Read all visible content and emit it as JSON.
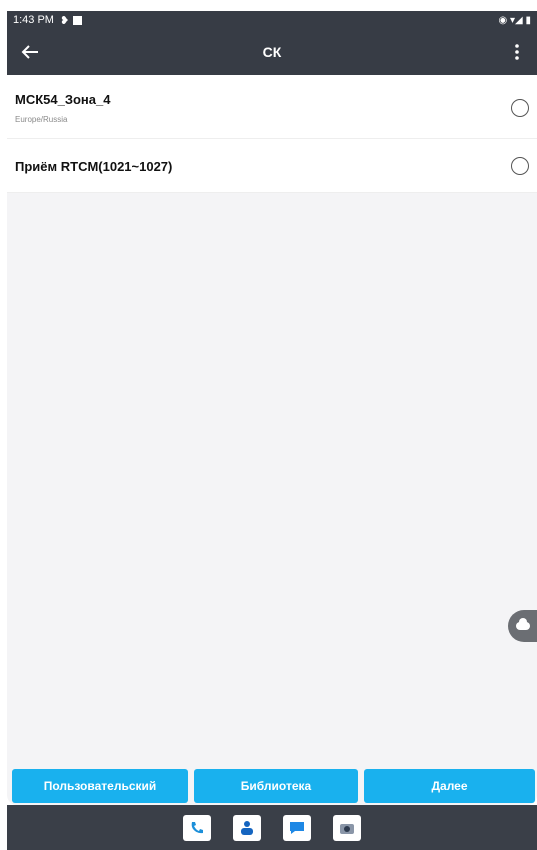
{
  "status_bar": {
    "time": "1:43 PM",
    "right_text": "◉ ▾◢ ▮"
  },
  "app_bar": {
    "title": "СК",
    "back_icon": "arrow-back-icon",
    "menu_icon": "more-vert-icon"
  },
  "list": {
    "items": [
      {
        "label": "МСК54_Зона_4",
        "sublabel": "Europe/Russia",
        "selected": false
      },
      {
        "label": "Приём RTCM(1021~1027)",
        "sublabel": "",
        "selected": false
      }
    ]
  },
  "buttons": {
    "custom_label": "Пользовательский",
    "library_label": "Библиотека",
    "next_label": "Далее"
  },
  "colors": {
    "header": "#373c45",
    "accent": "#19b1ee",
    "background": "#f4f4f6"
  },
  "nav": {
    "icons": [
      "phone-icon",
      "contacts-icon",
      "messages-icon",
      "camera-icon"
    ]
  }
}
